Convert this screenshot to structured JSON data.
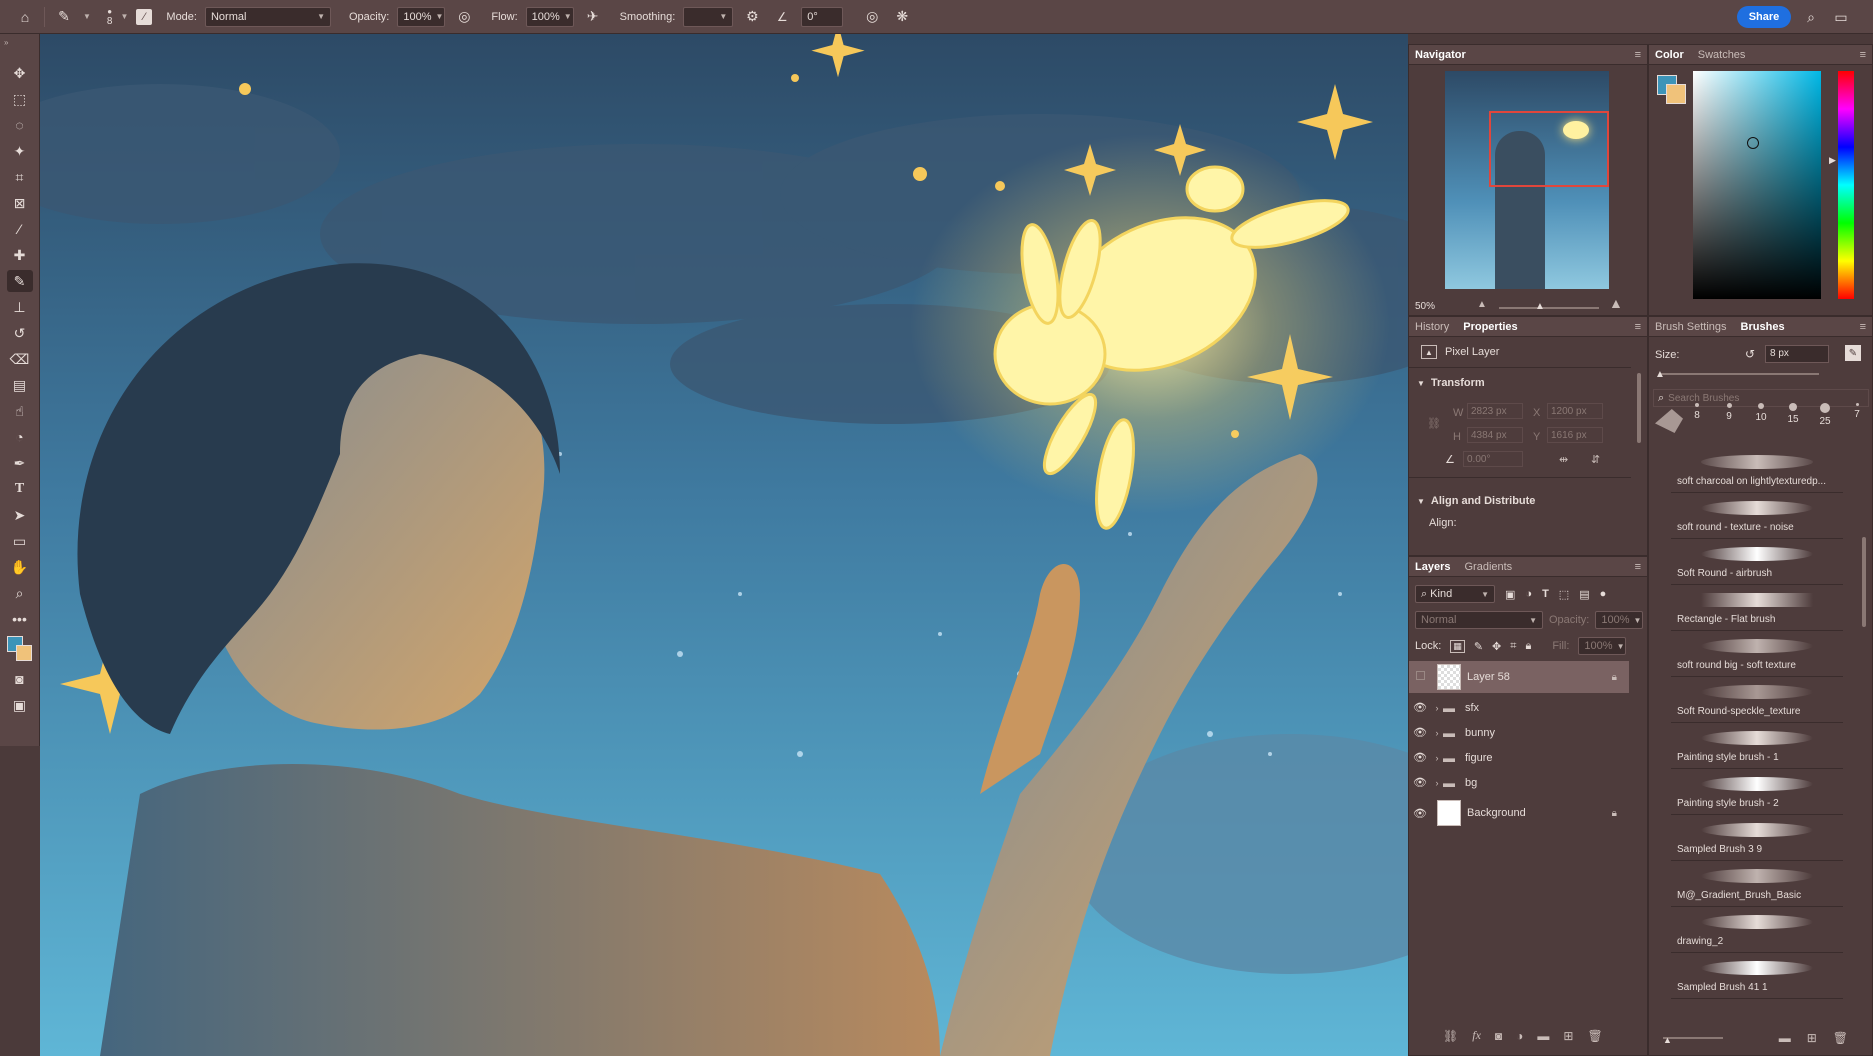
{
  "options_bar": {
    "brush_size": "8",
    "mode_label": "Mode:",
    "mode_value": "Normal",
    "opacity_label": "Opacity:",
    "opacity_value": "100%",
    "flow_label": "Flow:",
    "flow_value": "100%",
    "smoothing_label": "Smoothing:",
    "smoothing_value": "",
    "angle_value": "0°",
    "share_label": "Share"
  },
  "navigator": {
    "tabs": [
      "Navigator"
    ],
    "zoom": "50%"
  },
  "color_panel": {
    "tabs": [
      "Color",
      "Swatches"
    ],
    "foreground": "#3d94b8",
    "background": "#f0c27a"
  },
  "properties": {
    "tabs": [
      "History",
      "Properties"
    ],
    "layer_type": "Pixel Layer",
    "transform_title": "Transform",
    "w_label": "W",
    "w_value": "2823 px",
    "x_label": "X",
    "x_value": "1200 px",
    "h_label": "H",
    "h_value": "4384 px",
    "y_label": "Y",
    "y_value": "1616 px",
    "angle_value": "0.00°",
    "align_title": "Align and Distribute",
    "align_label": "Align:"
  },
  "layers": {
    "tabs": [
      "Layers",
      "Gradients"
    ],
    "filter_kind": "Kind",
    "blend_mode": "Normal",
    "opacity_label": "Opacity:",
    "opacity_value": "100%",
    "lock_label": "Lock:",
    "fill_label": "Fill:",
    "fill_value": "100%",
    "items": [
      {
        "name": "Layer 58",
        "type": "pixel"
      },
      {
        "name": "sfx",
        "type": "group"
      },
      {
        "name": "bunny",
        "type": "group"
      },
      {
        "name": "figure",
        "type": "group"
      },
      {
        "name": "bg",
        "type": "group"
      },
      {
        "name": "Background",
        "type": "background"
      }
    ]
  },
  "brushes": {
    "tabs": [
      "Brush Settings",
      "Brushes"
    ],
    "size_label": "Size:",
    "size_value": "8 px",
    "search_placeholder": "Search Brushes",
    "presets": [
      "8",
      "9",
      "10",
      "15",
      "25",
      "7"
    ],
    "items": [
      "soft charcoal on lightlytexturedp...",
      "soft round - texture - noise",
      "Soft Round  - airbrush",
      "Rectangle - Flat brush",
      "soft round big - soft texture",
      "Soft Round-speckle_texture",
      "Painting style brush - 1",
      "Painting style brush - 2",
      "Sampled Brush 3 9",
      "M@_Gradient_Brush_Basic",
      "drawing_2",
      "Sampled Brush 41 1"
    ]
  }
}
